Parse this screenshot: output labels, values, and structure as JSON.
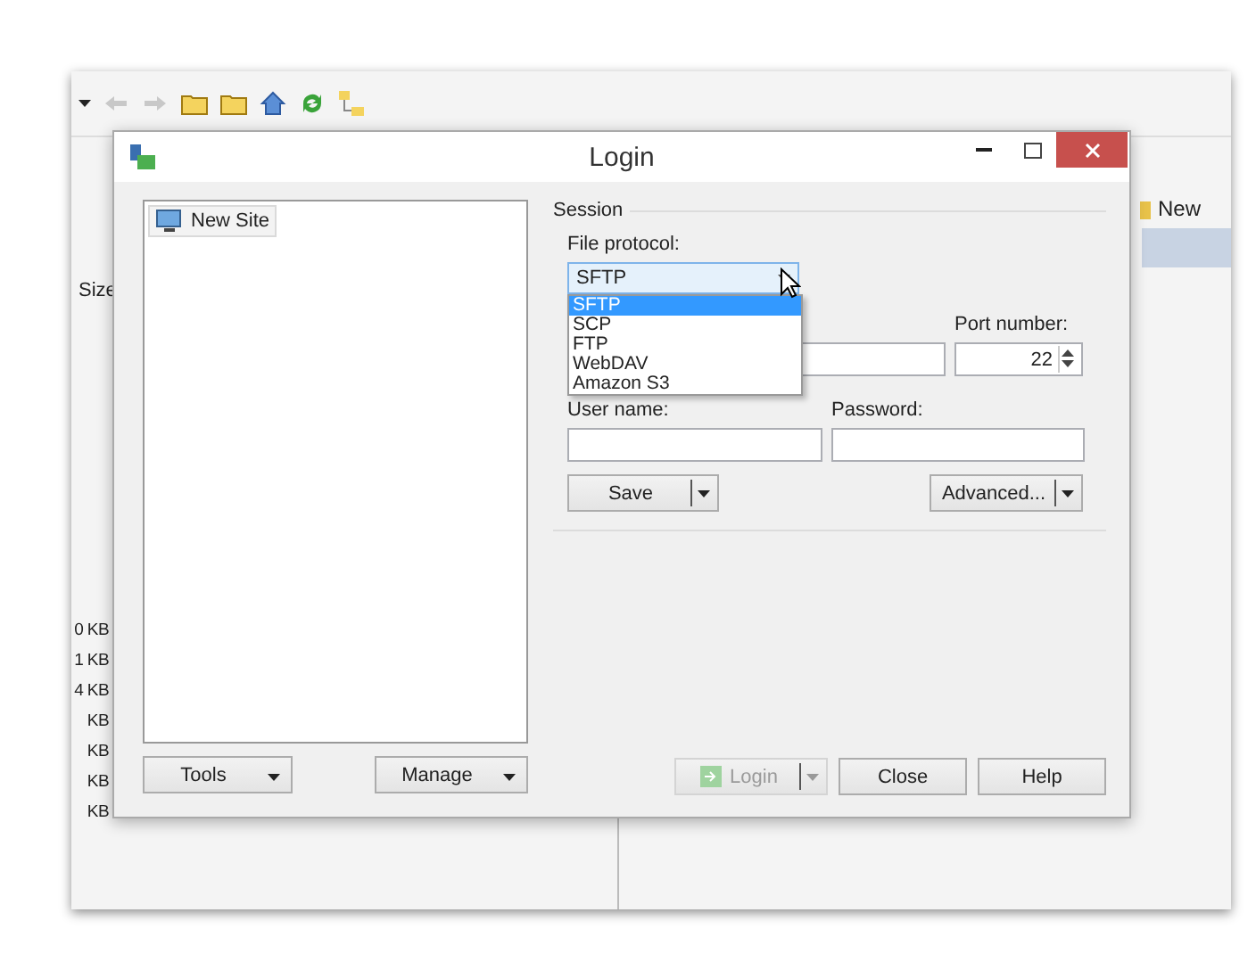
{
  "background_window": {
    "file_list": {
      "column_header": "Size",
      "sizes": [
        "0 KB",
        "1 KB",
        "4 KB",
        "KB",
        "KB",
        "KB",
        "KB"
      ]
    },
    "side_item": "New"
  },
  "dialog": {
    "title": "Login",
    "sites": [
      {
        "label": "New Site",
        "selected": true
      }
    ],
    "left_buttons": [
      "Tools",
      "Manage"
    ],
    "session": {
      "group_label": "Session",
      "file_protocol": {
        "label": "File protocol:",
        "value": "SFTP",
        "expanded": true,
        "options": [
          {
            "label": "SFTP",
            "selected": true
          },
          {
            "label": "SCP",
            "selected": false
          },
          {
            "label": "FTP",
            "selected": false
          },
          {
            "label": "WebDAV",
            "selected": false
          },
          {
            "label": "Amazon S3",
            "selected": false
          }
        ]
      },
      "port": {
        "label": "Port number:",
        "value": "22"
      },
      "user_name": {
        "label": "User name:"
      },
      "password": {
        "label": "Password:"
      },
      "buttons": [
        "Save",
        "Advanced..."
      ]
    },
    "bottom_buttons": [
      {
        "label": "Login",
        "disabled": true
      },
      {
        "label": "Close",
        "disabled": false
      },
      {
        "label": "Help",
        "disabled": false
      }
    ]
  }
}
